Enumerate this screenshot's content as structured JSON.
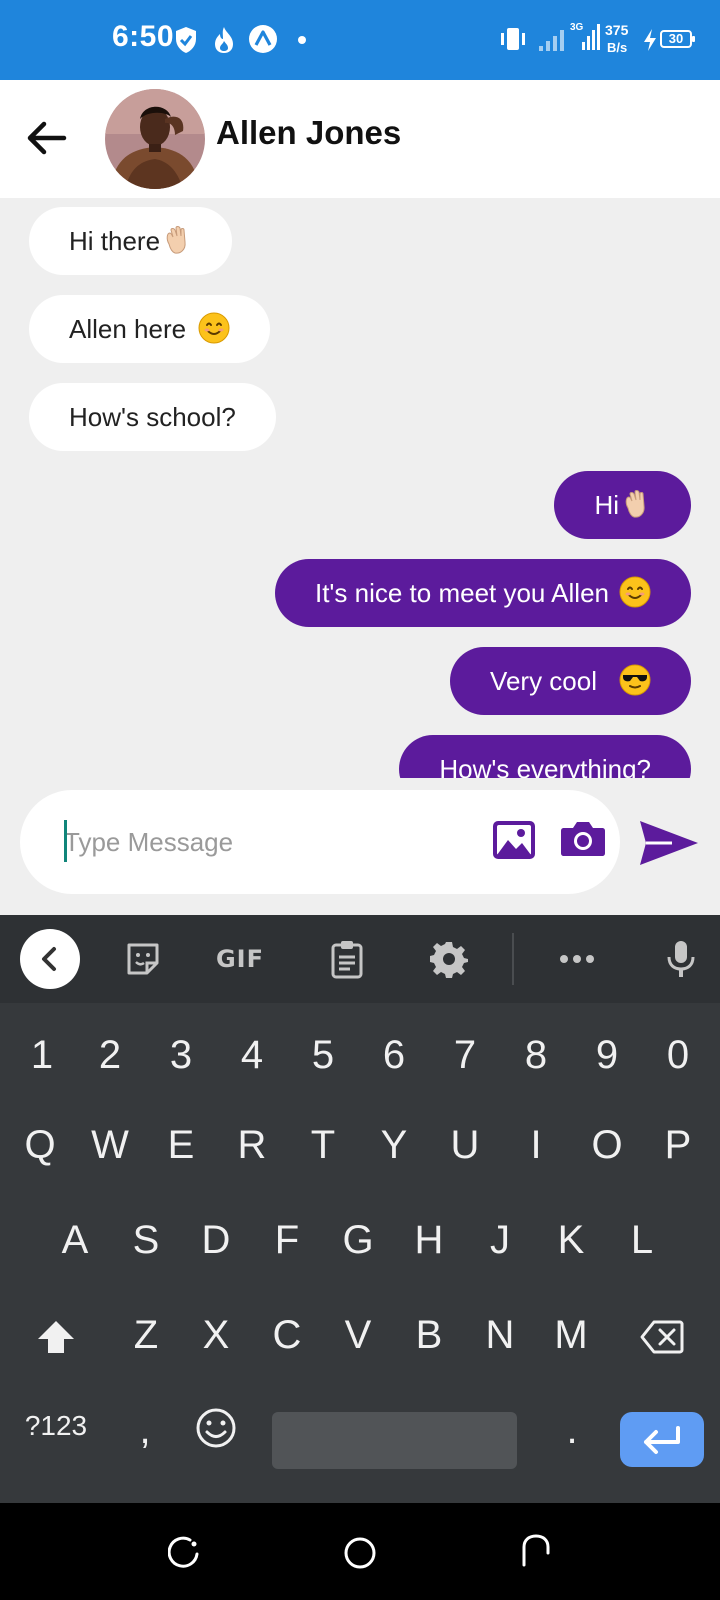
{
  "status_bar": {
    "time": "6:50",
    "net_speed_value": "375",
    "net_speed_unit": "B/s",
    "battery": "30",
    "network_type": "3G",
    "background_color": "#1f85dc"
  },
  "header": {
    "contact_name": "Allen Jones"
  },
  "messages": [
    {
      "direction": "incoming",
      "text": "Hi there",
      "emoji": "waving-hand"
    },
    {
      "direction": "incoming",
      "text": "Allen here",
      "emoji": "smiling-face"
    },
    {
      "direction": "incoming",
      "text": "How's school?",
      "emoji": ""
    },
    {
      "direction": "outgoing",
      "text": "Hi",
      "emoji": "waving-hand"
    },
    {
      "direction": "outgoing",
      "text": "It's nice to meet you Allen",
      "emoji": "smiling-face"
    },
    {
      "direction": "outgoing",
      "text": "Very cool",
      "emoji": "sunglasses-face"
    },
    {
      "direction": "outgoing",
      "text": "How's everything?",
      "emoji": ""
    }
  ],
  "composer": {
    "placeholder": "Type Message",
    "value": ""
  },
  "keyboard": {
    "toolbar": {
      "gif_label": "GIF"
    },
    "number_row": [
      "1",
      "2",
      "3",
      "4",
      "5",
      "6",
      "7",
      "8",
      "9",
      "0"
    ],
    "row1": [
      "Q",
      "W",
      "E",
      "R",
      "T",
      "Y",
      "U",
      "I",
      "O",
      "P"
    ],
    "row2": [
      "A",
      "S",
      "D",
      "F",
      "G",
      "H",
      "J",
      "K",
      "L"
    ],
    "row3": [
      "Z",
      "X",
      "C",
      "V",
      "B",
      "N",
      "M"
    ],
    "bottom": {
      "symbols": "?123",
      "comma": ",",
      "period": "."
    }
  },
  "colors": {
    "accent_purple": "#5c1b9c",
    "incoming_bubble": "#ffffff",
    "enter_key": "#5f9cf3"
  }
}
